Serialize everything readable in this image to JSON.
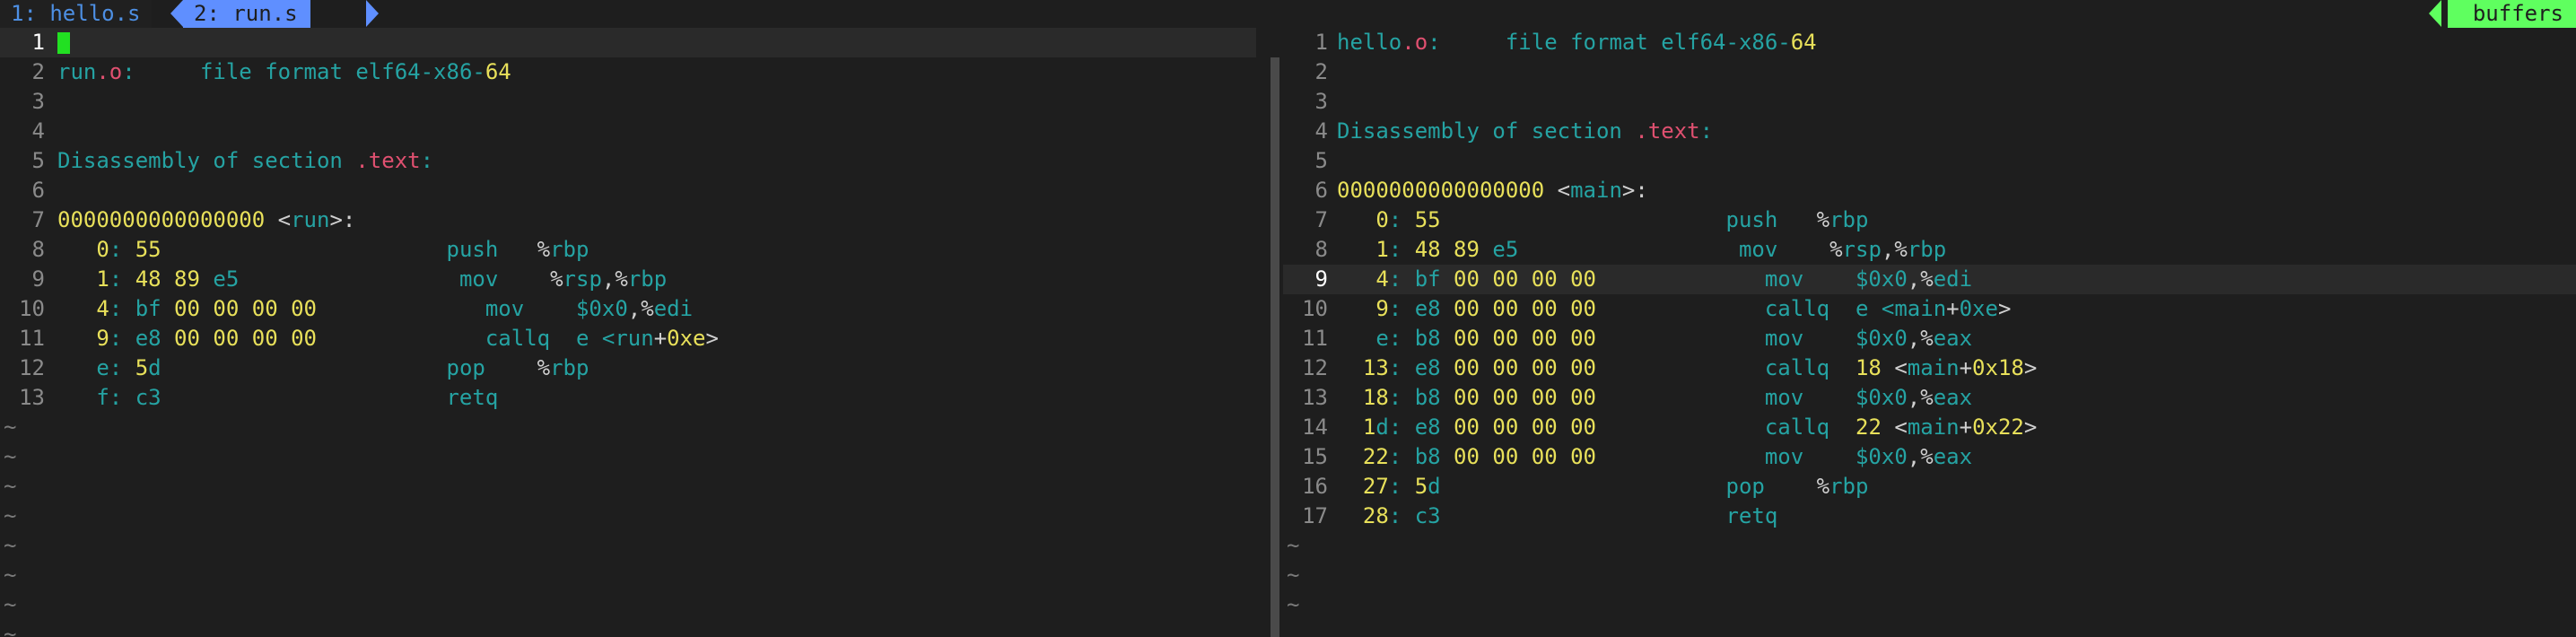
{
  "tabs": [
    {
      "label": "1: hello.s",
      "active": false
    },
    {
      "label": "2: run.s",
      "active": true
    }
  ],
  "buffers_label": "buffers",
  "colors": {
    "teal": "#25a3a3",
    "red": "#e05070",
    "yellow": "#e8e05a",
    "cursor": "#22e022",
    "active_tab": "#5f8fff",
    "buffers_badge": "#5fff5f"
  },
  "left_pane": {
    "current_line": 1,
    "lines": [
      {
        "n": "1",
        "segments": []
      },
      {
        "n": "2",
        "segments": [
          [
            "run",
            ""
          ],
          [
            ".o",
            "r"
          ],
          [
            ":     file format elf64-x86-",
            ""
          ],
          [
            "64",
            "y"
          ]
        ]
      },
      {
        "n": "3",
        "segments": []
      },
      {
        "n": "4",
        "segments": []
      },
      {
        "n": "5",
        "segments": [
          [
            "Disassembly of section ",
            ""
          ],
          [
            ".text",
            "r"
          ],
          [
            ":",
            ""
          ]
        ]
      },
      {
        "n": "6",
        "segments": []
      },
      {
        "n": "7",
        "segments": [
          [
            "0000000000000000",
            "y"
          ],
          [
            " <",
            "w"
          ],
          [
            "run",
            ""
          ],
          [
            ">:",
            "w"
          ]
        ]
      },
      {
        "n": "8",
        "segments": [
          [
            "   0",
            "y"
          ],
          [
            ": ",
            ""
          ],
          [
            "55",
            "y"
          ],
          [
            "                      push   ",
            ""
          ],
          [
            "%",
            "w"
          ],
          [
            "rbp",
            ""
          ]
        ]
      },
      {
        "n": "9",
        "segments": [
          [
            "   1",
            "y"
          ],
          [
            ": ",
            ""
          ],
          [
            "48 89",
            "y"
          ],
          [
            " e5                 mov    ",
            ""
          ],
          [
            "%",
            "w"
          ],
          [
            "rsp",
            ""
          ],
          [
            ",%",
            "w"
          ],
          [
            "rbp",
            ""
          ]
        ]
      },
      {
        "n": "10",
        "segments": [
          [
            "   4",
            "y"
          ],
          [
            ": bf ",
            ""
          ],
          [
            "00 00 00 00",
            "y"
          ],
          [
            "             mov    ",
            ""
          ],
          [
            "$0x0",
            ""
          ],
          [
            ",%",
            "w"
          ],
          [
            "edi",
            ""
          ]
        ]
      },
      {
        "n": "11",
        "segments": [
          [
            "   9",
            "y"
          ],
          [
            ": e8 ",
            ""
          ],
          [
            "00 00 00 00",
            "y"
          ],
          [
            "             callq  e <",
            ""
          ],
          [
            "run",
            ""
          ],
          [
            "+",
            "w"
          ],
          [
            "0xe",
            "y"
          ],
          [
            ">",
            "w"
          ]
        ]
      },
      {
        "n": "12",
        "segments": [
          [
            "   e: ",
            ""
          ],
          [
            "5",
            "y"
          ],
          [
            "d                      pop    ",
            ""
          ],
          [
            "%",
            "w"
          ],
          [
            "rbp",
            ""
          ]
        ]
      },
      {
        "n": "13",
        "segments": [
          [
            "   f: c3                      retq",
            ""
          ]
        ]
      }
    ],
    "tildes": 8
  },
  "right_pane": {
    "current_line": 9,
    "lines": [
      {
        "n": "1",
        "segments": [
          [
            "hello",
            ""
          ],
          [
            ".o",
            "r"
          ],
          [
            ":     file format elf64-x86-",
            ""
          ],
          [
            "64",
            "y"
          ]
        ]
      },
      {
        "n": "2",
        "segments": []
      },
      {
        "n": "3",
        "segments": []
      },
      {
        "n": "4",
        "segments": [
          [
            "Disassembly of section ",
            ""
          ],
          [
            ".text",
            "r"
          ],
          [
            ":",
            ""
          ]
        ]
      },
      {
        "n": "5",
        "segments": []
      },
      {
        "n": "6",
        "segments": [
          [
            "0000000000000000",
            "y"
          ],
          [
            " <",
            "w"
          ],
          [
            "main",
            ""
          ],
          [
            ">:",
            "w"
          ]
        ]
      },
      {
        "n": "7",
        "segments": [
          [
            "   0",
            "y"
          ],
          [
            ": ",
            ""
          ],
          [
            "55",
            "y"
          ],
          [
            "                      push   ",
            ""
          ],
          [
            "%",
            "w"
          ],
          [
            "rbp",
            ""
          ]
        ]
      },
      {
        "n": "8",
        "segments": [
          [
            "   1",
            "y"
          ],
          [
            ": ",
            ""
          ],
          [
            "48 89",
            "y"
          ],
          [
            " e5                 mov    ",
            ""
          ],
          [
            "%",
            "w"
          ],
          [
            "rsp",
            ""
          ],
          [
            ",%",
            "w"
          ],
          [
            "rbp",
            ""
          ]
        ]
      },
      {
        "n": "9",
        "segments": [
          [
            "   4",
            "y"
          ],
          [
            ": bf ",
            ""
          ],
          [
            "00 00 00 00",
            "y"
          ],
          [
            "             mov    ",
            ""
          ],
          [
            "$0x0",
            ""
          ],
          [
            ",%",
            "w"
          ],
          [
            "edi",
            ""
          ]
        ]
      },
      {
        "n": "10",
        "segments": [
          [
            "   9",
            "y"
          ],
          [
            ": e8 ",
            ""
          ],
          [
            "00 00 00 00",
            "y"
          ],
          [
            "             callq  e <",
            ""
          ],
          [
            "main",
            ""
          ],
          [
            "+",
            "w"
          ],
          [
            "0xe",
            ""
          ],
          [
            ">",
            "w"
          ]
        ]
      },
      {
        "n": "11",
        "segments": [
          [
            "   e: b8 ",
            ""
          ],
          [
            "00 00 00 00",
            "y"
          ],
          [
            "             mov    ",
            ""
          ],
          [
            "$0x0",
            ""
          ],
          [
            ",%",
            "w"
          ],
          [
            "eax",
            ""
          ]
        ]
      },
      {
        "n": "12",
        "segments": [
          [
            "  13",
            "y"
          ],
          [
            ": e8 ",
            ""
          ],
          [
            "00 00 00 00",
            "y"
          ],
          [
            "             callq  ",
            ""
          ],
          [
            "18",
            "y"
          ],
          [
            " <",
            "w"
          ],
          [
            "main",
            ""
          ],
          [
            "+",
            "w"
          ],
          [
            "0x18",
            "y"
          ],
          [
            ">",
            "w"
          ]
        ]
      },
      {
        "n": "13",
        "segments": [
          [
            "  18",
            "y"
          ],
          [
            ": b8 ",
            ""
          ],
          [
            "00 00 00 00",
            "y"
          ],
          [
            "             mov    ",
            ""
          ],
          [
            "$0x0",
            ""
          ],
          [
            ",%",
            "w"
          ],
          [
            "eax",
            ""
          ]
        ]
      },
      {
        "n": "14",
        "segments": [
          [
            "  1",
            "y"
          ],
          [
            "d",
            ""
          ],
          [
            ": e8 ",
            ""
          ],
          [
            "00 00 00 00",
            "y"
          ],
          [
            "             callq  ",
            ""
          ],
          [
            "22",
            "y"
          ],
          [
            " <",
            "w"
          ],
          [
            "main",
            ""
          ],
          [
            "+",
            "w"
          ],
          [
            "0x22",
            "y"
          ],
          [
            ">",
            "w"
          ]
        ]
      },
      {
        "n": "15",
        "segments": [
          [
            "  22",
            "y"
          ],
          [
            ": b8 ",
            ""
          ],
          [
            "00 00 00 00",
            "y"
          ],
          [
            "             mov    ",
            ""
          ],
          [
            "$0x0",
            ""
          ],
          [
            ",%",
            "w"
          ],
          [
            "eax",
            ""
          ]
        ]
      },
      {
        "n": "16",
        "segments": [
          [
            "  27",
            "y"
          ],
          [
            ": ",
            ""
          ],
          [
            "5",
            "y"
          ],
          [
            "d                      pop    ",
            ""
          ],
          [
            "%",
            "w"
          ],
          [
            "rbp",
            ""
          ]
        ]
      },
      {
        "n": "17",
        "segments": [
          [
            "  28",
            "y"
          ],
          [
            ": c3                      retq",
            ""
          ]
        ]
      }
    ],
    "tildes": 3
  }
}
